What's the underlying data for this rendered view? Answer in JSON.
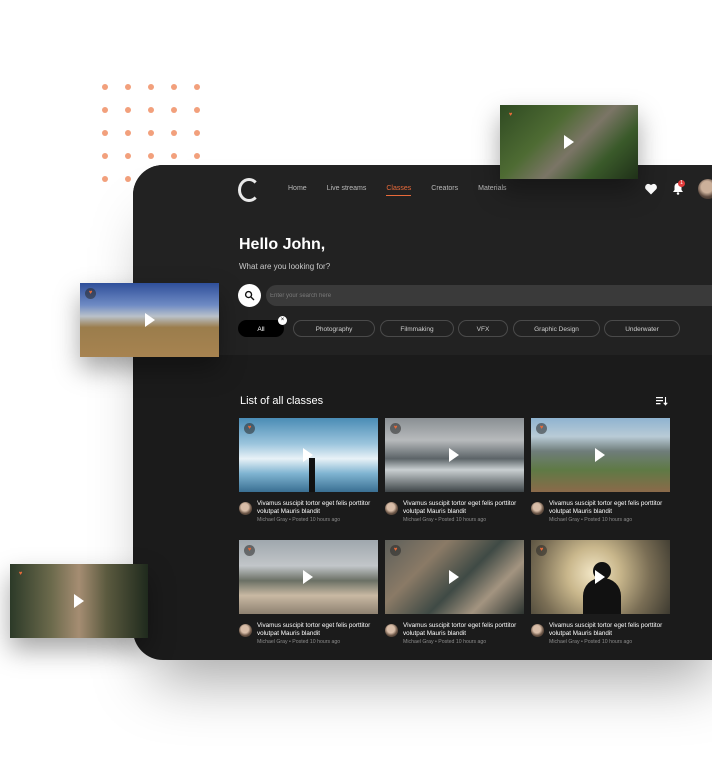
{
  "nav": {
    "items": [
      "Home",
      "Live streams",
      "Classes",
      "Creators",
      "Materials"
    ],
    "active_index": 2,
    "notification_count": "1"
  },
  "hero": {
    "greeting": "Hello John,",
    "subtitle": "What are you looking for?",
    "search_placeholder": "Enter your search here"
  },
  "filters": [
    "All",
    "Photography",
    "Filmmaking",
    "VFX",
    "Graphic Design",
    "Underwater"
  ],
  "list": {
    "title": "List of all classes",
    "cards": [
      {
        "title": "Vivamus suscipit tortor eget felis porttitor volutpat Mauris blandit",
        "author": "Michael Gray",
        "posted": "Posted 10 hours ago"
      },
      {
        "title": "Vivamus suscipit tortor eget felis porttitor volutpat Mauris blandit",
        "author": "Michael Gray",
        "posted": "Posted 10 hours ago"
      },
      {
        "title": "Vivamus suscipit tortor eget felis porttitor volutpat Mauris blandit",
        "author": "Michael Gray",
        "posted": "Posted 10 hours ago"
      },
      {
        "title": "Vivamus suscipit tortor eget felis porttitor volutpat Mauris blandit",
        "author": "Michael Gray",
        "posted": "Posted 10 hours ago"
      },
      {
        "title": "Vivamus suscipit tortor eget felis porttitor volutpat Mauris blandit",
        "author": "Michael Gray",
        "posted": "Posted 10 hours ago"
      },
      {
        "title": "Vivamus suscipit tortor eget felis porttitor volutpat Mauris blandit",
        "author": "Michael Gray",
        "posted": "Posted 10 hours ago"
      }
    ]
  },
  "colors": {
    "accent": "#e86a3a",
    "panel": "#1b1b1b",
    "dots": "#f2a07c"
  },
  "icons": [
    "logo-icon",
    "heart-icon",
    "bell-icon",
    "search-icon",
    "sort-icon",
    "play-icon",
    "favorite-icon",
    "close-icon"
  ]
}
